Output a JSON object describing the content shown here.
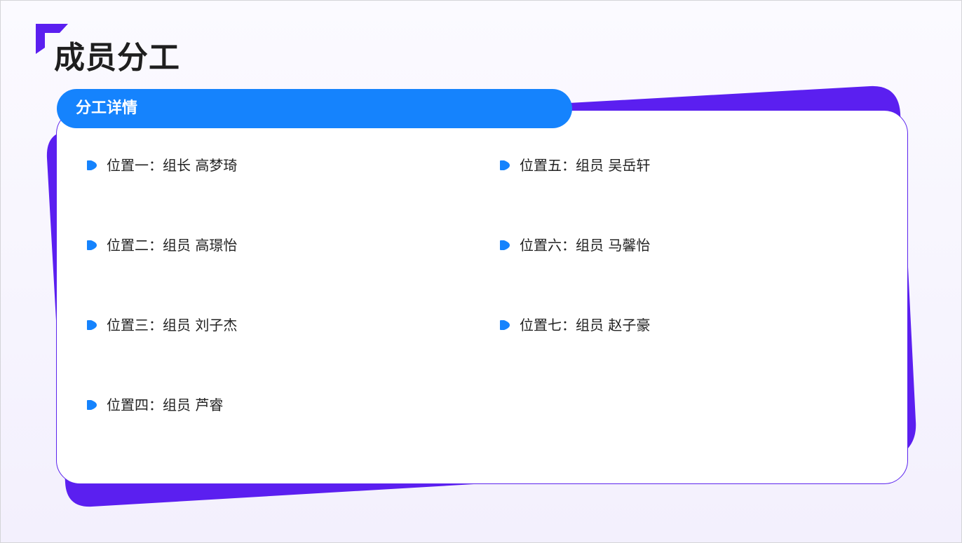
{
  "title": "成员分工",
  "section": {
    "tab_label": "分工详情"
  },
  "members_left": [
    {
      "text": "位置一：组长 高梦琦"
    },
    {
      "text": "位置二：组员 高璟怡"
    },
    {
      "text": "位置三：组员 刘子杰"
    },
    {
      "text": "位置四：组员 芦睿"
    }
  ],
  "members_right": [
    {
      "text": "位置五：组员 吴岳轩"
    },
    {
      "text": "位置六：组员 马馨怡"
    },
    {
      "text": "位置七：组员 赵子豪"
    }
  ],
  "colors": {
    "accent_purple": "#5b1ff0",
    "accent_blue": "#1583fd",
    "title_text": "#1f1f1f"
  },
  "icons": {
    "corner": "corner-bracket-icon",
    "bullet": "bullet-play-icon"
  }
}
